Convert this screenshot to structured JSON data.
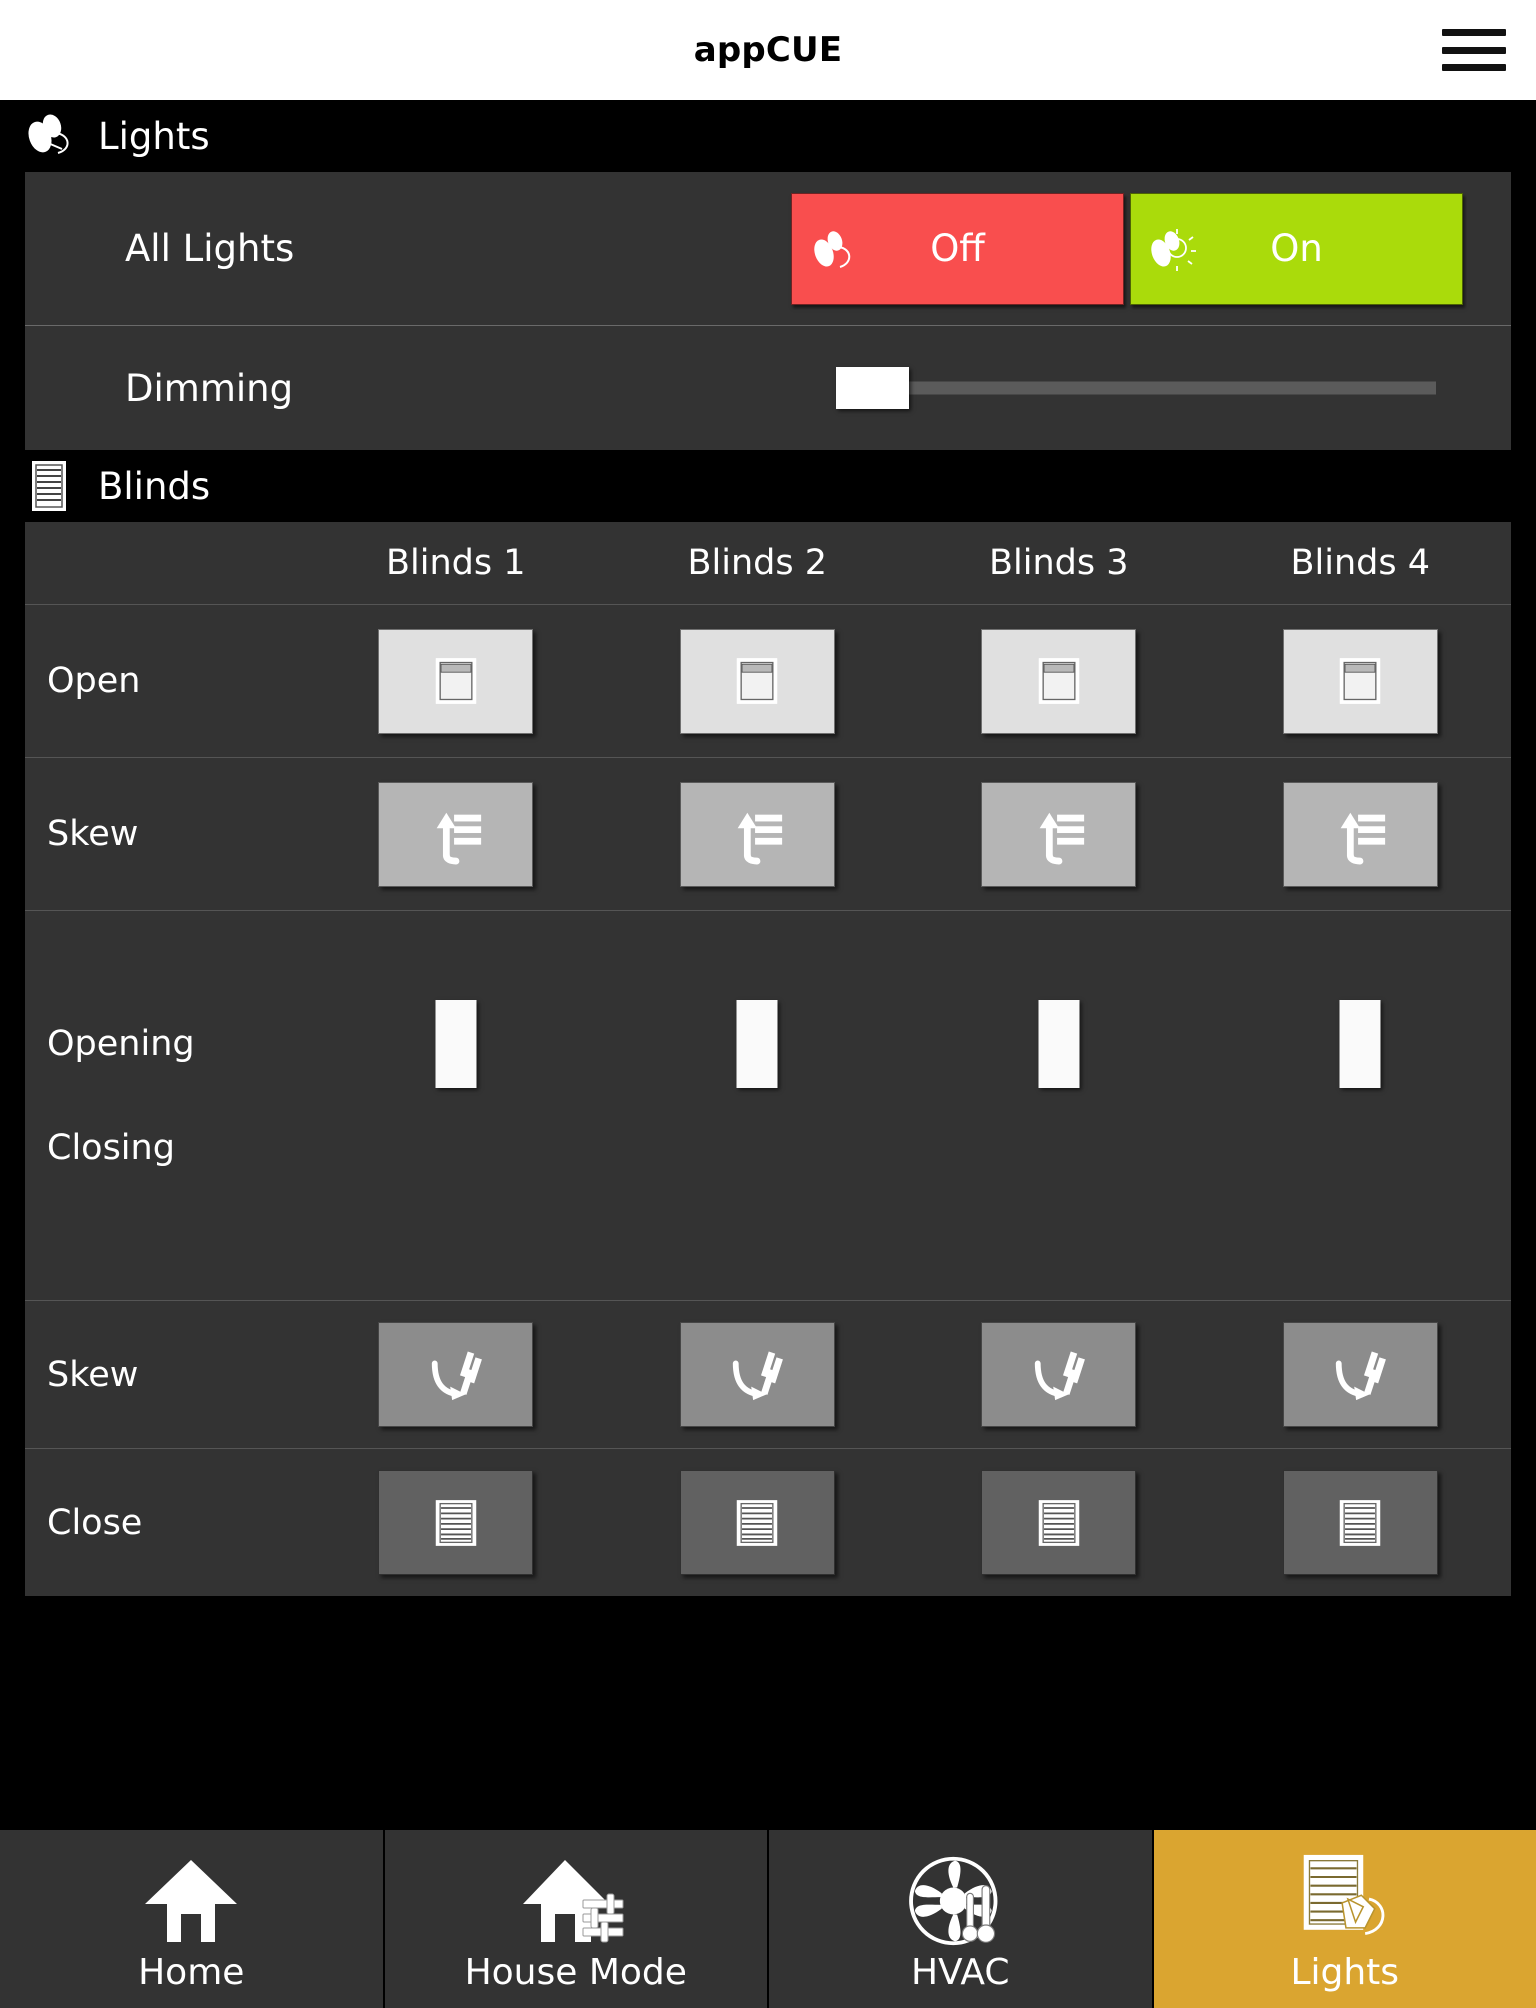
{
  "header": {
    "title": "appCUE",
    "menu_icon": "hamburger-menu-icon"
  },
  "sections": [
    {
      "id": "lights",
      "title": "Lights",
      "icon": "light-bulb-icon",
      "rows": {
        "all_lights": {
          "label": "All Lights",
          "off_label": "Off",
          "on_label": "On",
          "off_color": "#f94e4e",
          "on_color": "#aadb0b",
          "off_icon": "bulb-off-icon",
          "on_icon": "bulb-on-icon"
        },
        "dimming": {
          "label": "Dimming",
          "value_percent": 1
        }
      }
    },
    {
      "id": "blinds",
      "title": "Blinds",
      "icon": "blinds-closed-icon",
      "columns": [
        "Blinds 1",
        "Blinds 2",
        "Blinds 3",
        "Blinds 4"
      ],
      "rows": [
        {
          "label": "Open",
          "type": "buttons",
          "icon": "blind-open-icon",
          "button_color": "#e0e0e0"
        },
        {
          "label": "Skew",
          "type": "buttons",
          "icon": "skew-up-icon",
          "button_color": "#b5b5b5"
        },
        {
          "label_top": "Closing",
          "label_bottom": "Opening",
          "type": "vsliders",
          "values": [
            0,
            0,
            0,
            0
          ]
        },
        {
          "label": "Skew",
          "type": "buttons",
          "icon": "skew-down-icon",
          "button_color": "#8c8c8c"
        },
        {
          "label": "Close",
          "type": "buttons",
          "icon": "blinds-closed-icon",
          "button_color": "#616161"
        }
      ]
    }
  ],
  "bottom_nav": {
    "active_color": "#daa530",
    "items": [
      {
        "label": "Home",
        "icon": "home-icon",
        "active": false
      },
      {
        "label": "House Mode",
        "icon": "house-mode-icon",
        "active": false
      },
      {
        "label": "HVAC",
        "icon": "hvac-fan-icon",
        "active": false
      },
      {
        "label": "Lights",
        "icon": "blinds-hand-icon",
        "active": true
      }
    ]
  }
}
